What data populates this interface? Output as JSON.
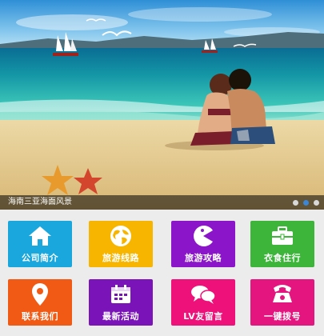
{
  "banner": {
    "caption": "海南三亚海面风景",
    "slide_count": 3,
    "active_slide": 2
  },
  "menu": {
    "tiles": [
      {
        "label": "公司简介",
        "icon": "home-icon",
        "color": "#1aa7dd"
      },
      {
        "label": "旅游线路",
        "icon": "globe-icon",
        "color": "#f7b500"
      },
      {
        "label": "旅游攻略",
        "icon": "pacman-icon",
        "color": "#8b16c9"
      },
      {
        "label": "衣食住行",
        "icon": "briefcase-icon",
        "color": "#3cb53a"
      },
      {
        "label": "联系我们",
        "icon": "map-pin-icon",
        "color": "#f05a14"
      },
      {
        "label": "最新活动",
        "icon": "calendar-icon",
        "color": "#7b14b8"
      },
      {
        "label": "LV友留言",
        "icon": "chat-bubbles-icon",
        "color": "#ee1179"
      },
      {
        "label": "一键拨号",
        "icon": "phone-icon",
        "color": "#e5157f"
      }
    ]
  }
}
